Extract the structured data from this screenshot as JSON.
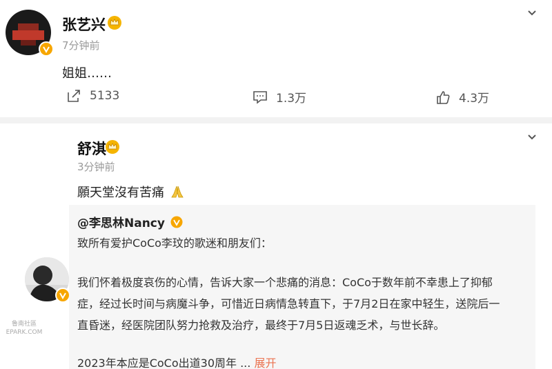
{
  "posts": [
    {
      "username": "张艺兴",
      "time": "7分钟前",
      "content": "姐姐……",
      "repost_count": "5133",
      "comment_count": "1.3万",
      "like_count": "4.3万"
    },
    {
      "username": "舒淇",
      "time": "3分钟前",
      "content": "願天堂沒有苦痛",
      "quote": {
        "author": "@李思林Nancy",
        "greeting": "致所有爱护CoCo李玟的歌迷和朋友们：",
        "body_lines": [
          "我们怀着极度哀伤的心情，告诉大家一个悲痛的消息：CoCo于数年前不幸患上了抑郁",
          "症，经过长时间与病魔斗争，可惜近日病情急转直下，于7月2日在家中轻生，送院后一",
          "直昏迷，经医院团队努力抢救及治疗，最终于7月5日返魂乏术，与世长辞。"
        ],
        "more_text": "2023年本应是CoCo出道30周年 ...",
        "expand_label": "展开"
      }
    }
  ],
  "watermark": {
    "line1": "魯南社區",
    "line2": "EPARK.COM"
  },
  "colors": {
    "accent_orange": "#eb7350",
    "verified_badge": "#f7a600",
    "separator": "#f2f2f2",
    "quote_bg": "#f6f6f6"
  },
  "icons": [
    "chevron-down-icon",
    "crown-badge-icon",
    "verified-badge-icon",
    "repost-icon",
    "comment-icon",
    "like-icon",
    "praying-hands-icon"
  ]
}
